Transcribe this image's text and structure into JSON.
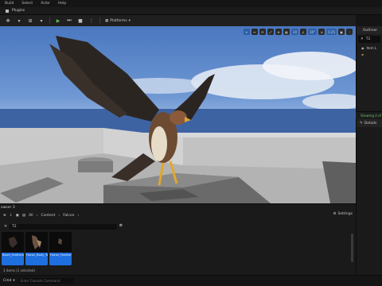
{
  "menu": [
    "Build",
    "Select",
    "Actor",
    "Help"
  ],
  "tabbar": {
    "plugins_label": "Plugins"
  },
  "toolbar": {
    "platforms_label": "Platforms"
  },
  "viewport": {
    "buttons": [
      "⌖",
      "↔",
      "⟳",
      "⤢",
      "⊕",
      "▦",
      "10",
      "∠",
      "10°",
      "⇲",
      "0.25",
      "▣",
      "⋮"
    ]
  },
  "outliner": {
    "title": "Outliner",
    "filter": "T2",
    "row": "Item L"
  },
  "showing": {
    "label": "Showing 4 of"
  },
  "details": {
    "title": "Details"
  },
  "content_browser": {
    "tab_label": "owser 3",
    "path": [
      "All",
      "Content",
      "Falcon"
    ],
    "settings_label": "Settings",
    "search_value": "T2",
    "assets": [
      {
        "name": "Black_Feathers_Tex"
      },
      {
        "name": "Falcon_Body_Tex"
      },
      {
        "name": "Falcon_Feathers_Tex"
      }
    ],
    "status": "3 items (1 selected)"
  },
  "statusbar": {
    "cmd_label": "Cmd",
    "cmd_placeholder": "Enter Console Command"
  }
}
